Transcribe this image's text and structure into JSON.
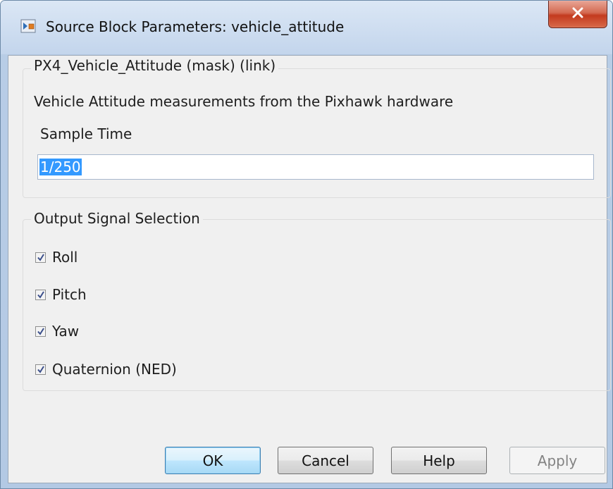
{
  "window": {
    "title": "Source Block Parameters: vehicle_attitude",
    "close_icon": "close-icon"
  },
  "block_group": {
    "title": "PX4_Vehicle_Attitude (mask) (link)",
    "description": "Vehicle Attitude measurements from the Pixhawk hardware",
    "sample_time_label": "Sample Time",
    "sample_time_value": "1/250"
  },
  "signals_group": {
    "title": "Output Signal Selection",
    "items": [
      {
        "label": "Roll",
        "checked": true
      },
      {
        "label": "Pitch",
        "checked": true
      },
      {
        "label": "Yaw",
        "checked": true
      },
      {
        "label": "Quaternion (NED)",
        "checked": true
      }
    ]
  },
  "buttons": {
    "ok": "OK",
    "cancel": "Cancel",
    "help": "Help",
    "apply": "Apply"
  },
  "colors": {
    "selection": "#3399ff",
    "close_button": "#c33a1e"
  }
}
